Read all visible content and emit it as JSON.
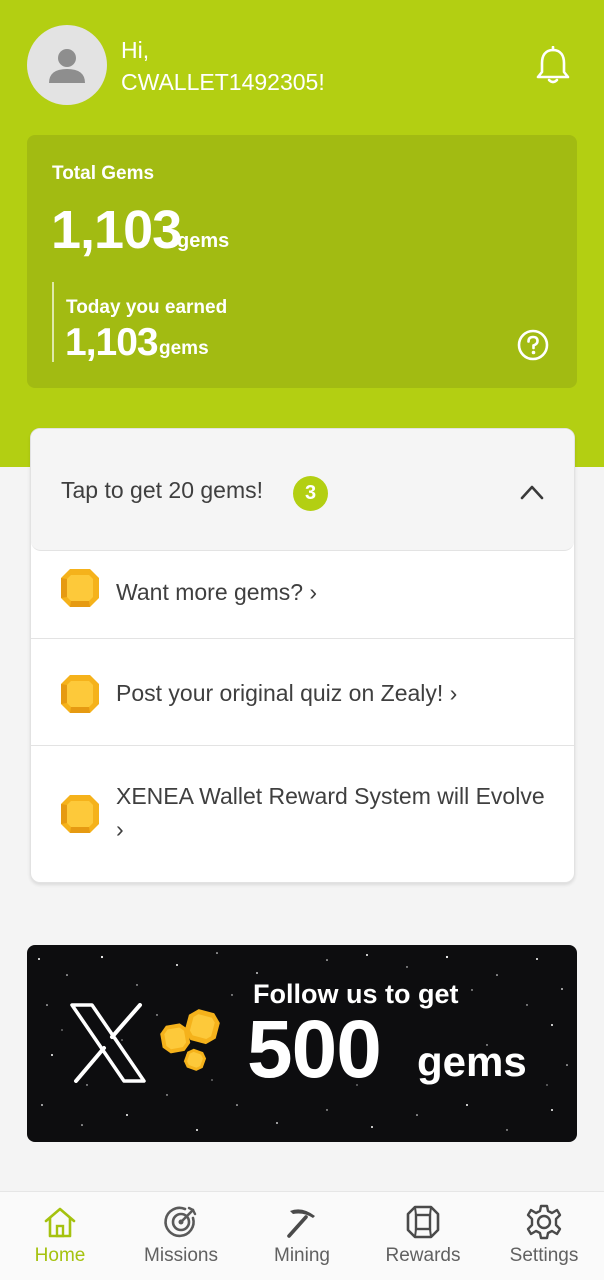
{
  "header": {
    "greeting": "Hi,",
    "username": "CWALLET1492305!",
    "avatar_icon": "user-avatar-icon",
    "notification_icon": "bell-icon"
  },
  "gems_card": {
    "total_label": "Total Gems",
    "total_value": "1,103",
    "total_unit": "gems",
    "today_label": "Today you earned",
    "today_value": "1,103",
    "today_unit": "gems",
    "help_icon": "question-circle-icon"
  },
  "tasks": {
    "title": "Tap to get 20 gems!",
    "count": "3",
    "collapse_icon": "chevron-up-icon",
    "items": [
      {
        "label": "Want more gems? ›",
        "icon": "gem-icon"
      },
      {
        "label": "Post your original quiz on Zealy! ›",
        "icon": "gem-icon"
      },
      {
        "label": "XENEA Wallet Reward System will Evolve ›",
        "icon": "gem-icon"
      }
    ]
  },
  "banner": {
    "line1": "Follow us to get",
    "amount": "500",
    "unit": "gems",
    "logo": "x-logo-icon"
  },
  "nav": {
    "items": [
      {
        "label": "Home",
        "icon": "home-icon",
        "active": true
      },
      {
        "label": "Missions",
        "icon": "target-icon",
        "active": false
      },
      {
        "label": "Mining",
        "icon": "pickaxe-icon",
        "active": false
      },
      {
        "label": "Rewards",
        "icon": "gem-outline-icon",
        "active": false
      },
      {
        "label": "Settings",
        "icon": "gear-icon",
        "active": false
      }
    ]
  },
  "colors": {
    "brand": "#b3cf12",
    "card": "#a2bb12",
    "active_nav": "#a5c20f",
    "gem": "#f5b21b"
  }
}
